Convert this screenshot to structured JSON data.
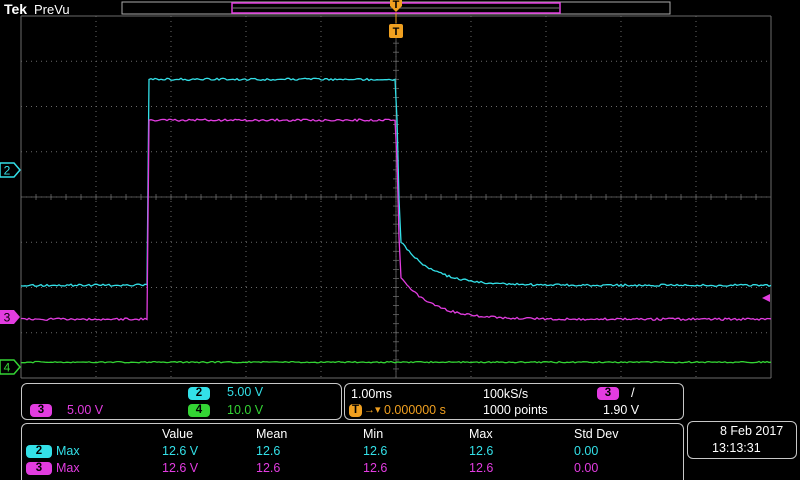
{
  "header": {
    "brand": "Tek",
    "mode": "PreVu",
    "trigger_marker": "T"
  },
  "colors": {
    "ch2": "#33e0e8",
    "ch3": "#e23ce0",
    "ch4": "#34d434",
    "trigger": "#f0a020",
    "grid": "#6a6a6a",
    "panel_border": "#c8c8c8"
  },
  "traces": {
    "ch2": {
      "label": "2",
      "baseline_divs": 2.05,
      "high_divs": 6.6,
      "rise_time_ms": -3.3,
      "fall_time_ms": 0.0,
      "tail_end_divs": 2.05
    },
    "ch3": {
      "label": "3",
      "baseline_divs": 1.3,
      "high_divs": 5.7,
      "rise_time_ms": -3.3,
      "fall_time_ms": 0.0,
      "tail_end_divs": 1.3
    },
    "ch4": {
      "label": "4",
      "level_divs": 0.35
    }
  },
  "channel_settings": {
    "ch2": {
      "number": "2",
      "scale": "5.00 V"
    },
    "ch3": {
      "number": "3",
      "scale": "5.00 V"
    },
    "ch4": {
      "number": "4",
      "scale": "10.0 V"
    }
  },
  "timebase": {
    "scale": "1.00ms",
    "trigger_position": "0.000000 s",
    "sample_rate": "100kS/s",
    "record_length": "1000 points",
    "trigger_source": "3",
    "trigger_slope": "/",
    "trigger_level": "1.90 V"
  },
  "measurements": {
    "headers": [
      "Value",
      "Mean",
      "Min",
      "Max",
      "Std Dev"
    ],
    "rows": [
      {
        "channel": "2",
        "name": "Max",
        "value": "12.6 V",
        "mean": "12.6",
        "min": "12.6",
        "max": "12.6",
        "std_dev": "0.00"
      },
      {
        "channel": "3",
        "name": "Max",
        "value": "12.6 V",
        "mean": "12.6",
        "min": "12.6",
        "max": "12.6",
        "std_dev": "0.00"
      }
    ]
  },
  "datetime": {
    "date": "8 Feb  2017",
    "time": "13:13:31"
  }
}
